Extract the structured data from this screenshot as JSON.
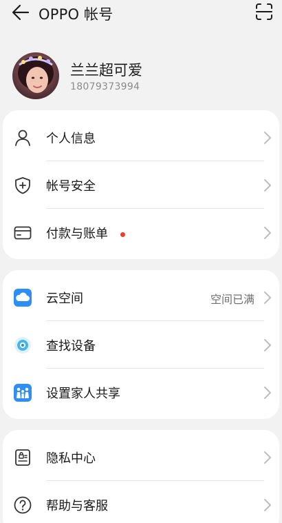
{
  "header": {
    "title": "OPPO 帐号"
  },
  "profile": {
    "name": "兰兰超可爱",
    "phone": "18079373994"
  },
  "group1": {
    "items": [
      {
        "label": "个人信息",
        "icon": "person-icon"
      },
      {
        "label": "帐号安全",
        "icon": "shield-plus-icon"
      },
      {
        "label": "付款与账单",
        "icon": "card-icon",
        "badge": "red-dot"
      }
    ]
  },
  "group2": {
    "items": [
      {
        "label": "云空间",
        "icon": "cloud-icon",
        "value": "空间已满"
      },
      {
        "label": "查找设备",
        "icon": "find-device-icon"
      },
      {
        "label": "设置家人共享",
        "icon": "family-icon"
      }
    ]
  },
  "group3": {
    "items": [
      {
        "label": "隐私中心",
        "icon": "privacy-icon"
      },
      {
        "label": "帮助与客服",
        "icon": "help-icon"
      }
    ]
  },
  "colors": {
    "background": "#f2f2f2",
    "card": "#ffffff",
    "accent_blue": "#2f8ef6",
    "badge_red": "#e8412c",
    "chevron": "#bdbdbd"
  }
}
